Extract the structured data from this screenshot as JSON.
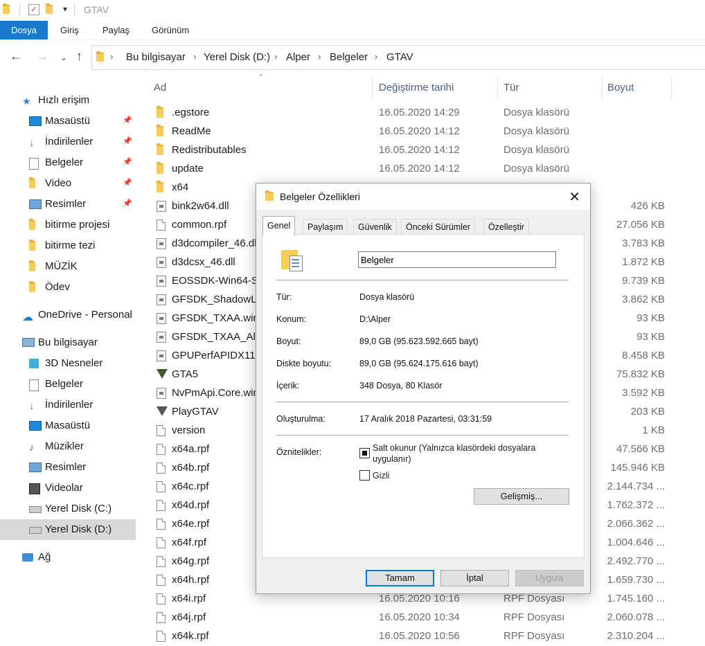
{
  "window": {
    "title": "GTAV"
  },
  "ribbon": {
    "tabs": [
      "Dosya",
      "Giriş",
      "Paylaş",
      "Görünüm"
    ]
  },
  "address": {
    "crumbs": [
      "Bu bilgisayar",
      "Yerel Disk (D:)",
      "Alper",
      "Belgeler",
      "GTAV"
    ]
  },
  "sidebar": {
    "items": [
      {
        "label": "Hızlı erişim",
        "icon": "star-icon"
      },
      {
        "label": "Masaüstü",
        "icon": "desktop-icon",
        "pinned": true
      },
      {
        "label": "İndirilenler",
        "icon": "download-icon",
        "pinned": true
      },
      {
        "label": "Belgeler",
        "icon": "documents-icon",
        "pinned": true
      },
      {
        "label": "Video",
        "icon": "folder-icon",
        "pinned": true
      },
      {
        "label": "Resimler",
        "icon": "pictures-icon",
        "pinned": true
      },
      {
        "label": "bitirme projesi",
        "icon": "folder-icon"
      },
      {
        "label": "bitirme tezi",
        "icon": "folder-icon"
      },
      {
        "label": "MÜZİK",
        "icon": "folder-icon"
      },
      {
        "label": "Ödev",
        "icon": "folder-icon"
      },
      {
        "label": "OneDrive - Personal",
        "icon": "cloud-icon"
      },
      {
        "label": "Bu bilgisayar",
        "icon": "computer-icon"
      },
      {
        "label": "3D Nesneler",
        "icon": "cube-icon"
      },
      {
        "label": "Belgeler",
        "icon": "documents-icon"
      },
      {
        "label": "İndirilenler",
        "icon": "download-icon"
      },
      {
        "label": "Masaüstü",
        "icon": "desktop-icon"
      },
      {
        "label": "Müzikler",
        "icon": "music-icon"
      },
      {
        "label": "Resimler",
        "icon": "pictures-icon"
      },
      {
        "label": "Videolar",
        "icon": "video-icon"
      },
      {
        "label": "Yerel Disk (C:)",
        "icon": "drive-icon"
      },
      {
        "label": "Yerel Disk (D:)",
        "icon": "drive-icon",
        "selected": true
      },
      {
        "label": "Ağ",
        "icon": "network-icon"
      }
    ]
  },
  "columns": {
    "name": "Ad",
    "date": "Değiştirme tarihi",
    "type": "Tür",
    "size": "Boyut"
  },
  "files": [
    {
      "name": ".egstore",
      "date": "16.05.2020 14:29",
      "type": "Dosya klasörü",
      "size": "",
      "kind": "folder"
    },
    {
      "name": "ReadMe",
      "date": "16.05.2020 14:12",
      "type": "Dosya klasörü",
      "size": "",
      "kind": "folder"
    },
    {
      "name": "Redistributables",
      "date": "16.05.2020 14:12",
      "type": "Dosya klasörü",
      "size": "",
      "kind": "folder"
    },
    {
      "name": "update",
      "date": "16.05.2020 14:12",
      "type": "Dosya klasörü",
      "size": "",
      "kind": "folder"
    },
    {
      "name": "x64",
      "date": "",
      "type": "",
      "size": "",
      "kind": "folder"
    },
    {
      "name": "bink2w64.dll",
      "date": "",
      "type": "",
      "size": "426 KB",
      "kind": "dll"
    },
    {
      "name": "common.rpf",
      "date": "",
      "type": "",
      "size": "27.056 KB",
      "kind": "file"
    },
    {
      "name": "d3dcompiler_46.dll",
      "date": "",
      "type": "",
      "size": "3.783 KB",
      "kind": "dll"
    },
    {
      "name": "d3dcsx_46.dll",
      "date": "",
      "type": "",
      "size": "1.872 KB",
      "kind": "dll"
    },
    {
      "name": "EOSSDK-Win64-Shipping.dll",
      "date": "",
      "type": "",
      "size": "9.739 KB",
      "kind": "dll"
    },
    {
      "name": "GFSDK_ShadowLib.win64.dll",
      "date": "",
      "type": "",
      "size": "3.862 KB",
      "kind": "dll"
    },
    {
      "name": "GFSDK_TXAA.win64.dll",
      "date": "",
      "type": "",
      "size": "93 KB",
      "kind": "dll"
    },
    {
      "name": "GFSDK_TXAA_AlphaResolve.win64.dll",
      "date": "",
      "type": "",
      "size": "93 KB",
      "kind": "dll"
    },
    {
      "name": "GPUPerfAPIDX11-x64.dll",
      "date": "",
      "type": "",
      "size": "8.458 KB",
      "kind": "dll"
    },
    {
      "name": "GTA5",
      "date": "",
      "type": "",
      "size": "75.832 KB",
      "kind": "exe"
    },
    {
      "name": "NvPmApi.Core.win64.dll",
      "date": "",
      "type": "",
      "size": "3.592 KB",
      "kind": "dll"
    },
    {
      "name": "PlayGTAV",
      "date": "",
      "type": "",
      "size": "203 KB",
      "kind": "rs"
    },
    {
      "name": "version",
      "date": "",
      "type": "",
      "size": "1 KB",
      "kind": "file"
    },
    {
      "name": "x64a.rpf",
      "date": "",
      "type": "",
      "size": "47.566 KB",
      "kind": "file"
    },
    {
      "name": "x64b.rpf",
      "date": "",
      "type": "",
      "size": "145.946 KB",
      "kind": "file"
    },
    {
      "name": "x64c.rpf",
      "date": "",
      "type": "",
      "size": "2.144.734 ...",
      "kind": "file"
    },
    {
      "name": "x64d.rpf",
      "date": "",
      "type": "",
      "size": "1.762.372 ...",
      "kind": "file"
    },
    {
      "name": "x64e.rpf",
      "date": "",
      "type": "",
      "size": "2.066.362 ...",
      "kind": "file"
    },
    {
      "name": "x64f.rpf",
      "date": "",
      "type": "",
      "size": "1.004.646 ...",
      "kind": "file"
    },
    {
      "name": "x64g.rpf",
      "date": "",
      "type": "",
      "size": "2.492.770 ...",
      "kind": "file"
    },
    {
      "name": "x64h.rpf",
      "date": "",
      "type": "",
      "size": "1.659.730 ...",
      "kind": "file"
    },
    {
      "name": "x64i.rpf",
      "date": "16.05.2020 10:16",
      "type": "RPF Dosyası",
      "size": "1.745.160 ...",
      "kind": "file"
    },
    {
      "name": "x64j.rpf",
      "date": "16.05.2020 10:34",
      "type": "RPF Dosyası",
      "size": "2.060.078 ...",
      "kind": "file"
    },
    {
      "name": "x64k.rpf",
      "date": "16.05.2020 10:56",
      "type": "RPF Dosyası",
      "size": "2.310.204 ...",
      "kind": "file"
    }
  ],
  "dialog": {
    "title": "Belgeler Özellikleri",
    "tabs": [
      "Genel",
      "Paylaşım",
      "Güvenlik",
      "Önceki Sürümler",
      "Özelleştir"
    ],
    "name_value": "Belgeler",
    "props": {
      "type_label": "Tür:",
      "type_value": "Dosya klasörü",
      "location_label": "Konum:",
      "location_value": "D:\\Alper",
      "size_label": "Boyut:",
      "size_value": "89,0 GB (95.623.592.665 bayt)",
      "disk_size_label": "Diskte boyutu:",
      "disk_size_value": "89,0 GB (95.624.175.616 bayt)",
      "contents_label": "İçerik:",
      "contents_value": "348 Dosya, 80 Klasör",
      "created_label": "Oluşturulma:",
      "created_value": "17 Aralık 2018 Pazartesi, 03:31:59",
      "attributes_label": "Öznitelikler:",
      "readonly_label_line1": "Salt okunur (Yalnızca klasördeki dosyalara",
      "readonly_label_line2": "uygulanır)",
      "hidden_label": "Gizli"
    },
    "buttons": {
      "advanced": "Gelişmiş...",
      "ok": "Tamam",
      "cancel": "İptal",
      "apply": "Uygula"
    }
  }
}
